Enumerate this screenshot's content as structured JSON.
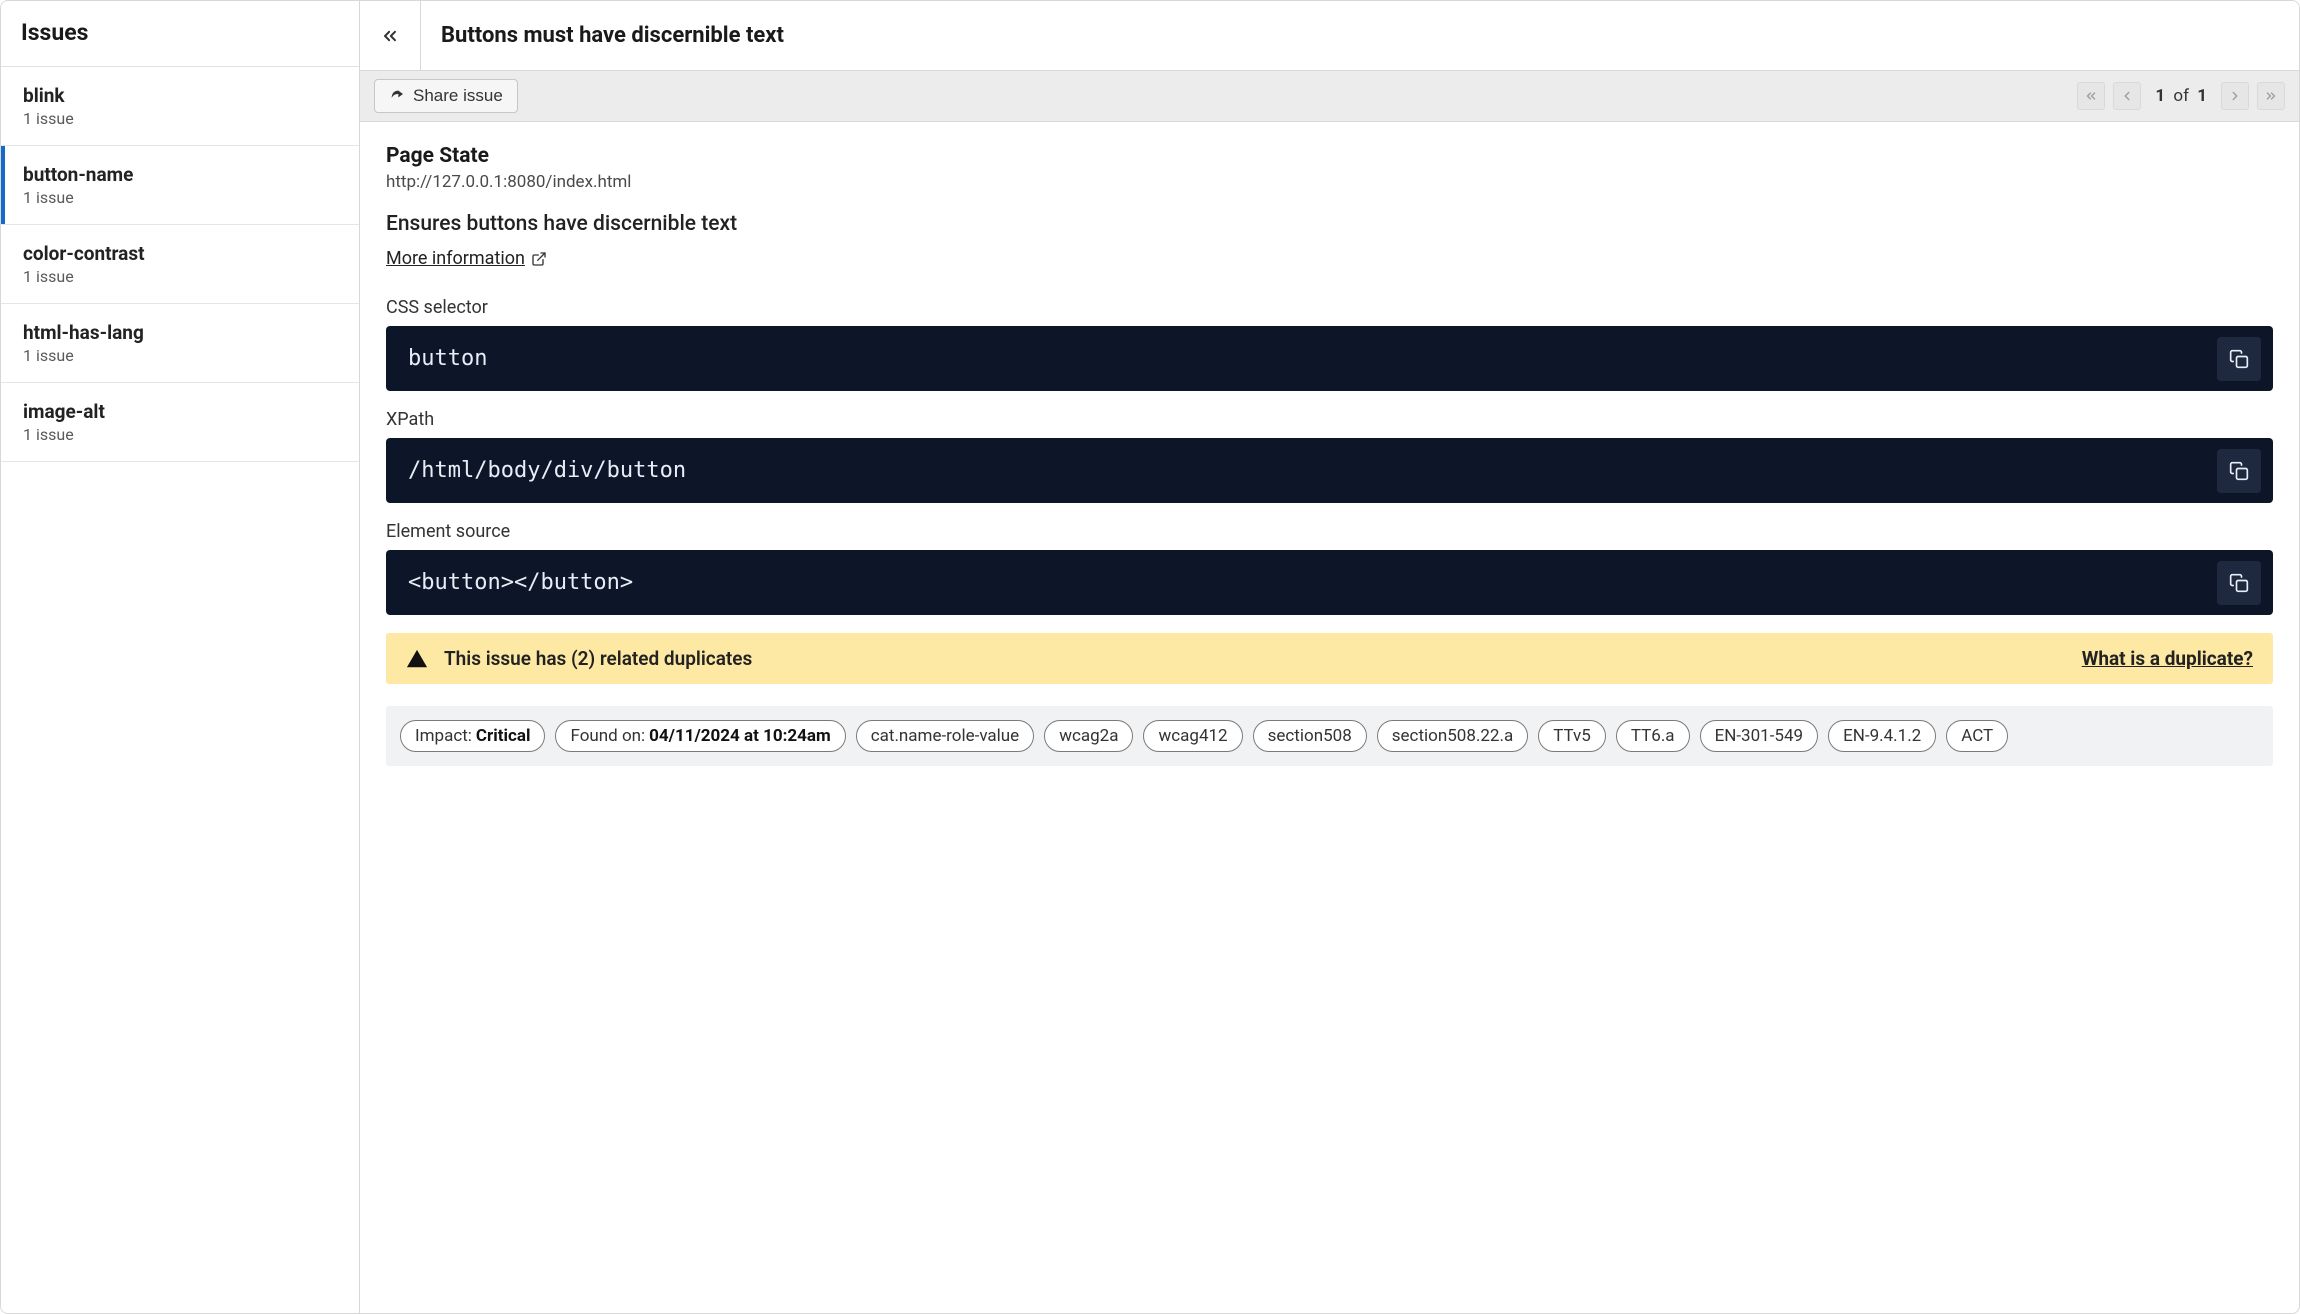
{
  "sidebar": {
    "title": "Issues",
    "items": [
      {
        "name": "blink",
        "count": "1 issue",
        "selected": false
      },
      {
        "name": "button-name",
        "count": "1 issue",
        "selected": true
      },
      {
        "name": "color-contrast",
        "count": "1 issue",
        "selected": false
      },
      {
        "name": "html-has-lang",
        "count": "1 issue",
        "selected": false
      },
      {
        "name": "image-alt",
        "count": "1 issue",
        "selected": false
      }
    ]
  },
  "header": {
    "title": "Buttons must have discernible text"
  },
  "toolbar": {
    "share_label": "Share issue",
    "pager": {
      "current": "1",
      "of_label": "of",
      "total": "1"
    }
  },
  "pageState": {
    "heading": "Page State",
    "url": "http://127.0.0.1:8080/index.html"
  },
  "description": "Ensures buttons have discernible text",
  "more_info": "More information",
  "selectors": {
    "css": {
      "label": "CSS selector",
      "value": "button"
    },
    "xpath": {
      "label": "XPath",
      "value": "/html/body/div/button"
    },
    "source": {
      "label": "Element source",
      "value": "<button></button>"
    }
  },
  "duplicates": {
    "message": "This issue has (2) related duplicates",
    "help_label": "What is a duplicate?"
  },
  "tags": {
    "impact": {
      "label": "Impact:",
      "value": "Critical"
    },
    "found_on": {
      "label": "Found on:",
      "value": "04/11/2024 at 10:24am"
    },
    "plain": [
      "cat.name-role-value",
      "wcag2a",
      "wcag412",
      "section508",
      "section508.22.a",
      "TTv5",
      "TT6.a",
      "EN-301-549",
      "EN-9.4.1.2",
      "ACT"
    ]
  }
}
